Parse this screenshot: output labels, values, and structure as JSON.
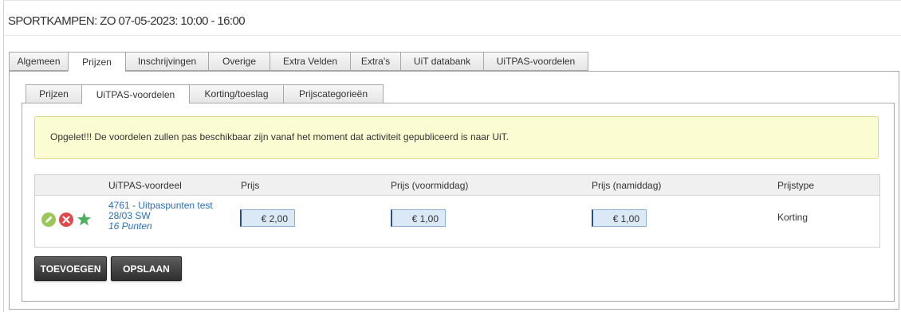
{
  "page": {
    "title": "SPORTKAMPEN: ZO 07-05-2023: 10:00 - 16:00"
  },
  "main_tabs": [
    {
      "label": "Algemeen"
    },
    {
      "label": "Prijzen"
    },
    {
      "label": "Inschrijvingen"
    },
    {
      "label": "Overige"
    },
    {
      "label": "Extra Velden"
    },
    {
      "label": "Extra's"
    },
    {
      "label": "UiT databank"
    },
    {
      "label": "UiTPAS-voordelen"
    }
  ],
  "main_tab_active": "Prijzen",
  "sub_tabs": [
    {
      "label": "Prijzen"
    },
    {
      "label": "UiTPAS-voordelen"
    },
    {
      "label": "Korting/toeslag"
    },
    {
      "label": "Prijscategorieën"
    }
  ],
  "sub_tab_active": "UiTPAS-voordelen",
  "warning": {
    "text": "Opgelet!!! De voordelen zullen pas beschikbaar zijn vanaf het moment dat activiteit gepubliceerd is naar UiT."
  },
  "table": {
    "headers": [
      "UiTPAS-voordeel",
      "Prijs",
      "Prijs (voormiddag)",
      "Prijs (namiddag)",
      "Prijstype"
    ],
    "rows": [
      {
        "icons": [
          "edit-icon",
          "delete-icon",
          "star-icon"
        ],
        "voordeel_line1": "4761 - Uitpaspunten test",
        "voordeel_line2": "28/03 SW",
        "punten": "16 Punten",
        "prijs": "€ 2,00",
        "prijs_voormiddag": "€ 1,00",
        "prijs_namiddag": "€ 1,00",
        "prijstype": "Korting"
      }
    ]
  },
  "buttons": {
    "toevoegen": "TOEVOEGEN",
    "opslaan": "OPSLAAN"
  },
  "colors": {
    "link": "#2a6fb3",
    "edit_icon": "#9bc75a",
    "delete_icon": "#e0484b",
    "star_icon": "#4db05e",
    "warning_bg": "#fcfcd3",
    "input_bg": "#dbe9f7",
    "button_bg": "#3a3a3a"
  }
}
